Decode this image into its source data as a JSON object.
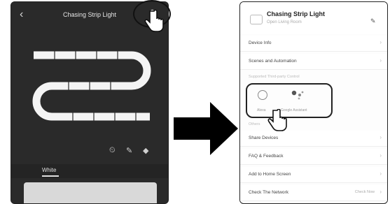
{
  "left_screen": {
    "title": "Chasing Strip Light",
    "back_icon": "back-arrow-icon",
    "edit_icon": "pencil-icon",
    "tabs": [
      "White",
      "",
      ""
    ],
    "bottom_icons": [
      "timer-icon",
      "pen-icon",
      "eraser-icon"
    ]
  },
  "right_screen": {
    "device_name": "Chasing Strip Light",
    "device_subtitle": "Open Living Room",
    "rows": [
      {
        "label": "Device Info",
        "value": ""
      },
      {
        "label": "Scenes and Automation",
        "value": ""
      }
    ],
    "section_third_party": "Supported Third-party Control",
    "options": [
      {
        "label": "Alexa",
        "icon": "alexa-icon"
      },
      {
        "label": "Google Assistant",
        "icon": "google-assistant-icon"
      }
    ],
    "section_others": "Others",
    "rows_bottom": [
      {
        "label": "Share Devices",
        "value": ""
      },
      {
        "label": "FAQ & Feedback",
        "value": ""
      },
      {
        "label": "Add to Home Screen",
        "value": ""
      },
      {
        "label": "Check The Network",
        "value": "Check Now"
      }
    ]
  },
  "colors": {
    "dark_bg": "#2a2a2a",
    "strip_white": "#f5f5f5",
    "accent": "#222222"
  }
}
